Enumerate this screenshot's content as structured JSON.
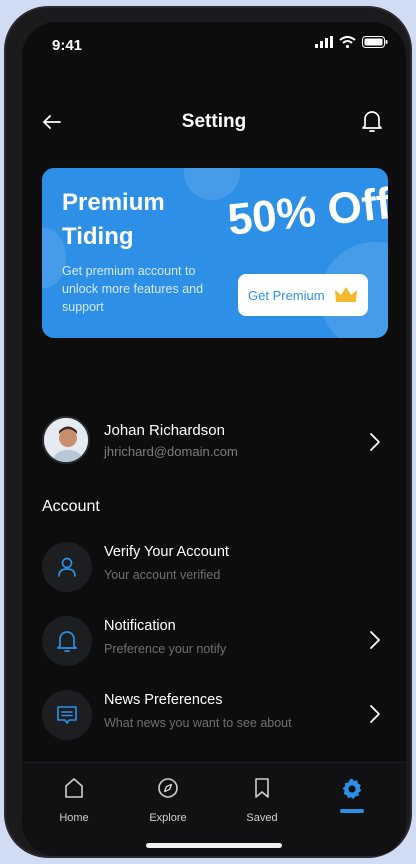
{
  "status_bar": {
    "time": "9:41",
    "signal_icon": "signal-icon",
    "wifi_icon": "wifi-icon",
    "battery_icon": "battery-icon"
  },
  "header": {
    "title": "Setting",
    "back_icon": "arrow-left-icon",
    "bell_icon": "bell-icon"
  },
  "promo": {
    "title": "Premium Tiding",
    "description": "Get premium account to unlock more features and support",
    "discount": "50% Off",
    "button_label": "Get Premium",
    "button_icon": "crown-icon",
    "background_color": "#2e8fe6"
  },
  "profile": {
    "name": "Johan Richardson",
    "email": "jhrichard@domain.com"
  },
  "account": {
    "section_title": "Account",
    "items": [
      {
        "title": "Verify Your Account",
        "subtitle": "Your account verified",
        "icon": "user-icon",
        "has_chevron": false
      },
      {
        "title": "Notification",
        "subtitle": "Preference your notify",
        "icon": "bell-icon",
        "has_chevron": true
      },
      {
        "title": "News Preferences",
        "subtitle": "What news you want to see about",
        "icon": "news-icon",
        "has_chevron": true
      }
    ]
  },
  "nav": {
    "items": [
      {
        "label": "Home",
        "icon": "home-icon",
        "active": false
      },
      {
        "label": "Explore",
        "icon": "compass-icon",
        "active": false
      },
      {
        "label": "Saved",
        "icon": "bookmark-icon",
        "active": false
      },
      {
        "label": "",
        "icon": "gear-icon",
        "active": true
      }
    ],
    "accent_color": "#2e8fe6"
  }
}
